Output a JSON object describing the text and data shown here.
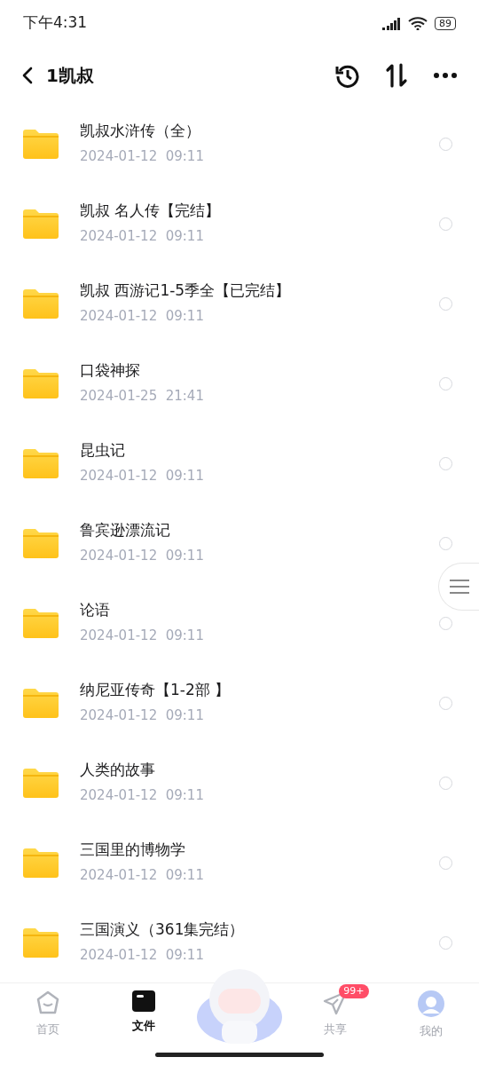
{
  "status_bar": {
    "time": "下午4:31",
    "battery": "89"
  },
  "header": {
    "title": "1凯叔"
  },
  "files": [
    {
      "name": "凯叔水浒传（全）",
      "modified": "2024-01-12  09:11",
      "selected": false
    },
    {
      "name": "凯叔 名人传【完结】",
      "modified": "2024-01-12  09:11",
      "selected": false
    },
    {
      "name": "凯叔 西游记1-5季全【已完结】",
      "modified": "2024-01-12  09:11",
      "selected": false
    },
    {
      "name": "口袋神探",
      "modified": "2024-01-25  21:41",
      "selected": false
    },
    {
      "name": "昆虫记",
      "modified": "2024-01-12  09:11",
      "selected": false
    },
    {
      "name": "鲁宾逊漂流记",
      "modified": "2024-01-12  09:11",
      "selected": false
    },
    {
      "name": "论语",
      "modified": "2024-01-12  09:11",
      "selected": false
    },
    {
      "name": "纳尼亚传奇【1-2部 】",
      "modified": "2024-01-12  09:11",
      "selected": false
    },
    {
      "name": "人类的故事",
      "modified": "2024-01-12  09:11",
      "selected": false
    },
    {
      "name": "三国里的博物学",
      "modified": "2024-01-12  09:11",
      "selected": false
    },
    {
      "name": "三国演义（361集完结）",
      "modified": "2024-01-12  09:11",
      "selected": false
    }
  ],
  "bottom_nav": [
    {
      "kind": "home",
      "label": "首页",
      "selected": false
    },
    {
      "kind": "files",
      "label": "文件",
      "selected": true
    },
    {
      "kind": "mascot"
    },
    {
      "kind": "share",
      "label": "共享",
      "selected": false,
      "badge": "99+"
    },
    {
      "kind": "profile",
      "label": "我的",
      "selected": false
    }
  ]
}
